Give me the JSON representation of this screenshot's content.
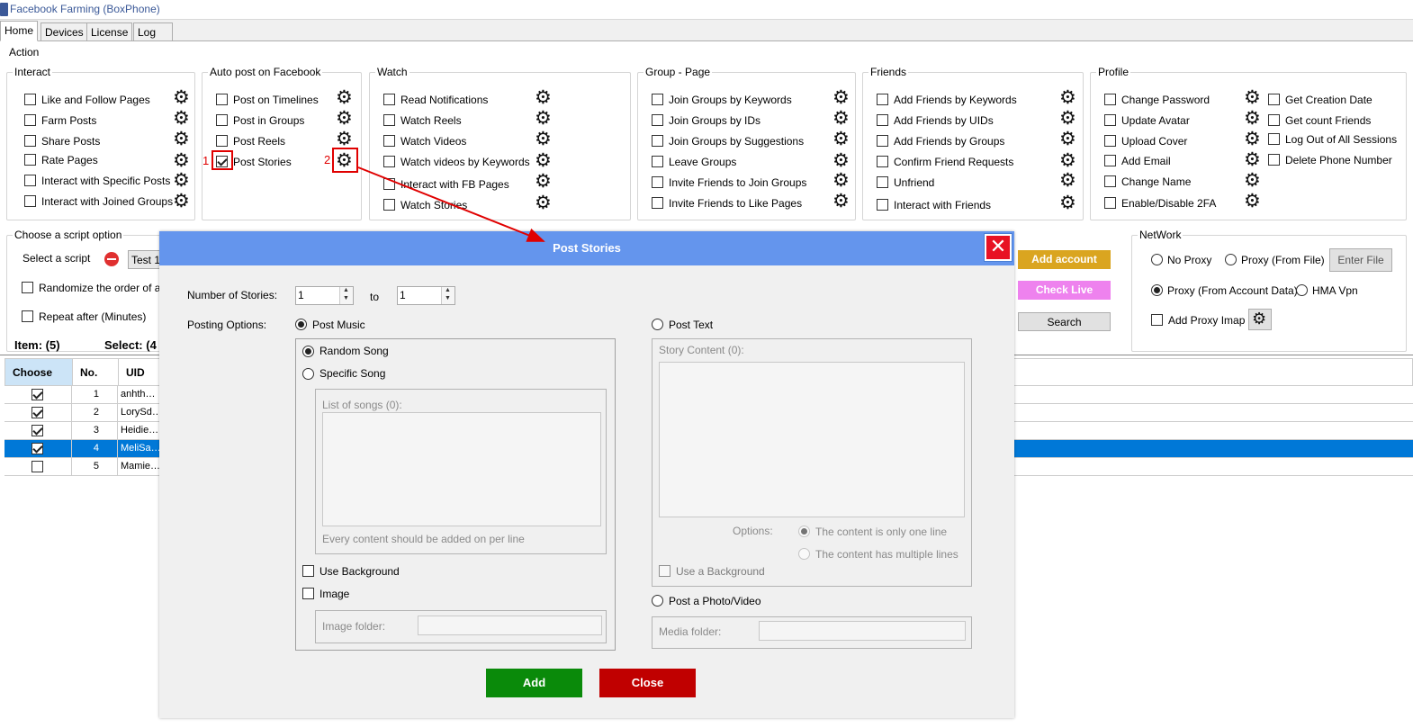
{
  "window": {
    "title": "Facebook Farming (BoxPhone)"
  },
  "tabs": [
    "Home",
    "Devices",
    "License",
    "Log"
  ],
  "action": {
    "title": "Action"
  },
  "interact": {
    "title": "Interact",
    "items": [
      "Like and Follow Pages",
      "Farm Posts",
      "Share Posts",
      "Rate Pages",
      "Interact with Specific Posts",
      "Interact with Joined Groups"
    ]
  },
  "autopost": {
    "title": "Auto post on Facebook",
    "items": [
      "Post on Timelines",
      "Post in Groups",
      "Post Reels",
      "Post Stories"
    ]
  },
  "watch": {
    "title": "Watch",
    "items": [
      "Read Notifications",
      "Watch Reels",
      "Watch Videos",
      "Watch videos by Keywords",
      "Interact with FB Pages",
      "Watch Stories"
    ]
  },
  "group": {
    "title": "Group - Page",
    "items": [
      "Join Groups by Keywords",
      "Join Groups by IDs",
      "Join Groups by Suggestions",
      "Leave Groups",
      "Invite Friends to Join Groups",
      "Invite Friends to Like Pages"
    ]
  },
  "friends": {
    "title": "Friends",
    "items": [
      "Add Friends by Keywords",
      "Add Friends by UIDs",
      "Add Friends by  Groups",
      "Confirm Friend Requests",
      "Unfriend",
      "Interact with Friends"
    ]
  },
  "profile": {
    "title": "Profile",
    "items": [
      "Change Password",
      "Update Avatar",
      "Upload Cover",
      "Add Email",
      "Change Name",
      "Enable/Disable 2FA"
    ],
    "items2": [
      "Get Creation Date",
      "Get count Friends",
      "Log Out of All Sessions",
      "Delete Phone Number"
    ]
  },
  "script": {
    "title": "Choose a script option",
    "select_label": "Select a script",
    "select_value": "Test 1",
    "randomize": "Randomize the order of actio",
    "repeat": "Repeat after (Minutes)"
  },
  "counts": {
    "items": "Item: (5)",
    "select": "Select: (4"
  },
  "buttons": {
    "add_account": "Add account",
    "check_live": "Check Live",
    "search": "Search"
  },
  "network": {
    "title": "NetWork",
    "no_proxy": "No Proxy",
    "proxy_file": "Proxy (From File)",
    "enter_file": "Enter File",
    "proxy_account": "Proxy (From Account Data)",
    "hma": "HMA Vpn",
    "add_proxy": "Add Proxy Imap"
  },
  "table": {
    "headers": [
      "Choose",
      "No.",
      "UID"
    ],
    "rows": [
      {
        "no": "1",
        "uid": "anhth…"
      },
      {
        "no": "2",
        "uid": "LorySd…"
      },
      {
        "no": "3",
        "uid": "Heidie…"
      },
      {
        "no": "4",
        "uid": "MeliSa…"
      },
      {
        "no": "5",
        "uid": "Mamie…"
      }
    ]
  },
  "annot": {
    "n1": "1",
    "n2": "2"
  },
  "dialog": {
    "title": "Post Stories",
    "close_glyph": "✕",
    "num_label": "Number of Stories:",
    "from": "1",
    "to_label": "to",
    "to": "1",
    "posting_label": "Posting Options:",
    "post_music": "Post Music",
    "random_song": "Random Song",
    "specific_song": "Specific Song",
    "list_songs": "List of songs (0):",
    "songs_hint": "Every content should be added on per line",
    "use_bg": "Use Background",
    "image": "Image",
    "image_folder": "Image folder:",
    "post_text": "Post Text",
    "story_content": "Story Content (0):",
    "options": "Options:",
    "one_line": "The content is only one line",
    "multi_line": "The content has multiple lines",
    "use_a_bg": "Use a Background",
    "post_photo": "Post a Photo/Video",
    "media_folder": "Media folder:",
    "add": "Add",
    "close": "Close"
  },
  "colors": {
    "dialog_title": "#6495ed",
    "add_green": "#0a8a0a",
    "close_red": "#c00000",
    "add_account": "#daa520",
    "check_live": "#ee82ee",
    "selected_row": "#0078d7"
  }
}
